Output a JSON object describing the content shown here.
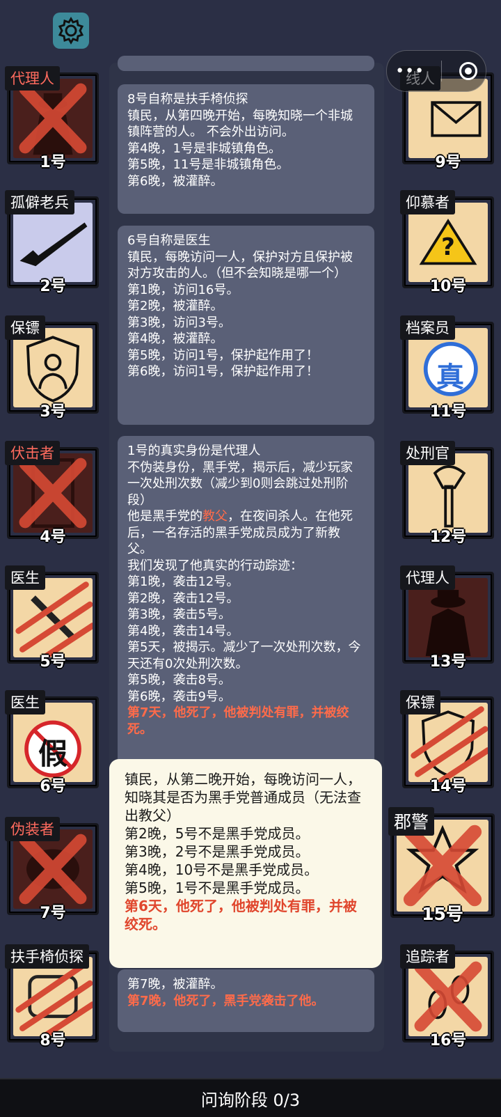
{
  "capsule": {
    "dots_label": "•••"
  },
  "cards_left": [
    {
      "role": "代理人",
      "role_color": "red",
      "number": "1号",
      "bg": "dark",
      "mark": "x",
      "icon": "agent-coat-icon"
    },
    {
      "role": "孤僻老兵",
      "role_color": "white",
      "number": "2号",
      "bg": "lav",
      "mark": "none",
      "icon": "rifle-icon"
    },
    {
      "role": "保镖",
      "role_color": "white",
      "number": "3号",
      "bg": "light",
      "mark": "none",
      "icon": "shield-person-icon"
    },
    {
      "role": "伏击者",
      "role_color": "red",
      "number": "4号",
      "bg": "dark",
      "mark": "x",
      "icon": "door-icon"
    },
    {
      "role": "医生",
      "role_color": "white",
      "number": "5号",
      "bg": "light",
      "mark": "claw",
      "icon": "syringe-icon"
    },
    {
      "role": "医生",
      "role_color": "white",
      "number": "6号",
      "bg": "light",
      "mark": "none",
      "icon": "fake-stamp-icon",
      "stamp_text": "假"
    },
    {
      "role": "伪装者",
      "role_color": "red",
      "number": "7号",
      "bg": "dark",
      "mark": "x",
      "icon": "mask-icon"
    },
    {
      "role": "扶手椅侦探",
      "role_color": "white",
      "number": "8号",
      "bg": "light",
      "mark": "claw",
      "icon": "armchair-icon"
    }
  ],
  "cards_right": [
    {
      "role": "线人",
      "role_color": "white",
      "number": "9号",
      "bg": "light",
      "mark": "none",
      "icon": "envelope-hand-icon"
    },
    {
      "role": "仰慕者",
      "role_color": "white",
      "number": "10号",
      "bg": "light",
      "mark": "none",
      "icon": "warning-question-icon",
      "stamp_text": "?"
    },
    {
      "role": "档案员",
      "role_color": "white",
      "number": "11号",
      "bg": "light",
      "mark": "none",
      "icon": "real-stamp-icon",
      "stamp_text": "真"
    },
    {
      "role": "处刑官",
      "role_color": "white",
      "number": "12号",
      "bg": "light",
      "mark": "none",
      "icon": "axe-icon"
    },
    {
      "role": "代理人",
      "role_color": "white",
      "number": "13号",
      "bg": "dark",
      "mark": "none",
      "icon": "agent-coat-icon"
    },
    {
      "role": "保镖",
      "role_color": "white",
      "number": "14号",
      "bg": "light",
      "mark": "claw",
      "icon": "shield-person-icon"
    },
    {
      "role": "郡警",
      "role_color": "white",
      "number": "15号",
      "bg": "light",
      "mark": "x",
      "icon": "sheriff-badge-icon"
    },
    {
      "role": "追踪者",
      "role_color": "white",
      "number": "16号",
      "bg": "light",
      "mark": "x",
      "icon": "footprint-icon"
    }
  ],
  "messages": [
    {
      "lines": [
        "8号自称是扶手椅侦探",
        "镇民，从第四晚开始，每晚知晓一个非城镇阵营的人。 不会外出访问。",
        "第4晚，1号是非城镇角色。",
        "第5晚，11号是非城镇角色。",
        "第6晚，被灌醉。"
      ]
    },
    {
      "lines": [
        "6号自称是医生",
        "镇民，每晚访问一人，保护对方且保护被对方攻击的人。（但不会知晓是哪一个）",
        "第1晚，访问16号。",
        "第2晚，被灌醉。",
        "第3晚，访问3号。",
        "第4晚，被灌醉。",
        "第5晚，访问1号，保护起作用了！",
        "第6晚，访问1号，保护起作用了！"
      ]
    },
    {
      "lines_a": [
        "1号的真实身份是代理人",
        "不伪装身份，黑手党，揭示后，减少玩家一次处刑次数（减少到0则会跳过处刑阶段）"
      ],
      "godfather_pre": "他是黑手党的",
      "godfather_word": "教父",
      "godfather_post": "，在夜间杀人。在他死后，一名存活的黑手党成员成为了新教父。",
      "lines_b": [
        "我们发现了他真实的行动踪迹：",
        "第1晚，袭击12号。",
        "第2晚，袭击12号。",
        "第3晚，袭击5号。",
        "第4晚，袭击14号。",
        "第5天，被揭示。减少了一次处刑次数，今天还有0次处刑次数。",
        "第5晚，袭击8号。",
        "第6晚，袭击9号。"
      ],
      "death": "第7天，他死了，他被判处有罪，并被绞死。"
    },
    {
      "tail_line": "第7晚，被灌醉。",
      "death": "第7晚，他死了，黑手党袭击了他。"
    }
  ],
  "popup": {
    "lines": [
      "镇民，从第二晚开始，每晚访问一人，知晓其是否为黑手党普通成员（无法查出教父）",
      "第2晚，5号不是黑手党成员。",
      "第3晚，2号不是黑手党成员。",
      "第4晚，10号不是黑手党成员。",
      "第5晚，1号不是黑手党成员。"
    ],
    "death": "第6天，他死了，他被判处有罪，并被绞死。"
  },
  "footer": {
    "phase_label": "问询阶段 0/3"
  }
}
